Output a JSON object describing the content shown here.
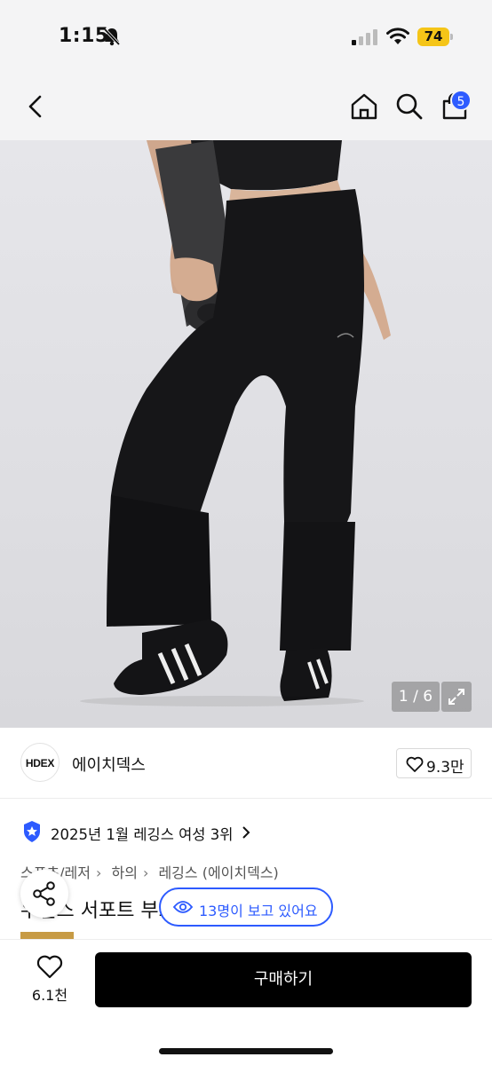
{
  "status_bar": {
    "time": "1:15",
    "battery": "74"
  },
  "nav": {
    "cart_count": "5"
  },
  "gallery": {
    "counter": "1 / 6"
  },
  "brand": {
    "logo_text": "HDEX",
    "name": "에이치덱스",
    "like_count": "9.3만"
  },
  "ranking": {
    "text": "2025년 1월 레깅스 여성 3위"
  },
  "breadcrumb": [
    "스포츠/레저",
    "하의",
    "레깅스 (에이치덱스)"
  ],
  "product": {
    "title": "우먼스 서포트 부츠컷 레깅스 (Black)"
  },
  "viewers": {
    "text": "13명이 보고 있어요"
  },
  "bottom": {
    "wish_count": "6.1천",
    "buy_label": "구매하기"
  },
  "colors": {
    "accent": "#2d5bff",
    "badge": "#f5c518",
    "buy_bg": "#000000"
  }
}
